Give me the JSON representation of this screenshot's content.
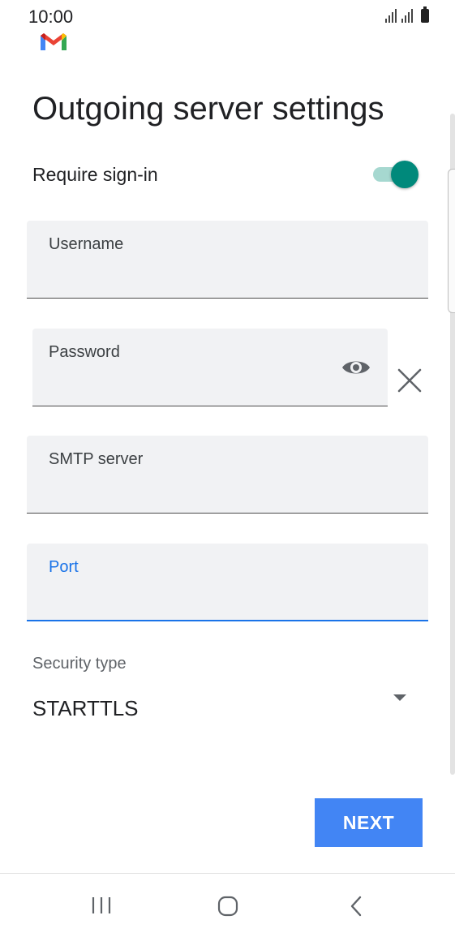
{
  "status_bar": {
    "time": "10:00",
    "icons": [
      "signal-icon",
      "signal-icon",
      "battery-icon"
    ]
  },
  "app": {
    "logo": "gmail-logo-icon"
  },
  "page": {
    "title": "Outgoing server settings"
  },
  "require_signin": {
    "label": "Require sign-in",
    "enabled": true,
    "accent_color": "#00897b"
  },
  "fields": {
    "username": {
      "label": "Username",
      "value": ""
    },
    "password": {
      "label": "Password",
      "value": ""
    },
    "smtp_server": {
      "label": "SMTP server",
      "value": ""
    },
    "port": {
      "label": "Port",
      "value": "",
      "focused": true,
      "focus_color": "#1a73e8"
    }
  },
  "security": {
    "label": "Security type",
    "value": "STARTTLS"
  },
  "actions": {
    "next_label": "NEXT",
    "next_color": "#4285f4"
  },
  "nav": {
    "icons": [
      "recents-icon",
      "home-icon",
      "back-icon"
    ]
  }
}
